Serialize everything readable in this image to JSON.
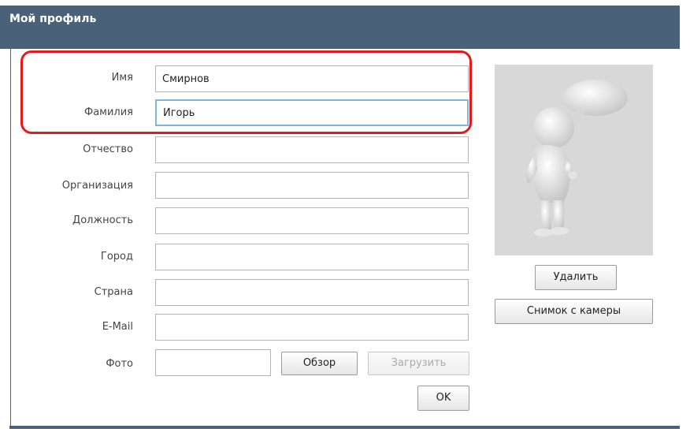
{
  "window": {
    "title": "Мой профиль"
  },
  "form": {
    "fields": [
      {
        "label": "Имя",
        "value": "Смирнов"
      },
      {
        "label": "Фамилия",
        "value": "Игорь"
      },
      {
        "label": "Отчество",
        "value": ""
      },
      {
        "label": "Организация",
        "value": ""
      },
      {
        "label": "Должность",
        "value": ""
      },
      {
        "label": "Город",
        "value": ""
      },
      {
        "label": "Страна",
        "value": ""
      },
      {
        "label": "E-Mail",
        "value": ""
      }
    ],
    "photo": {
      "label": "Фото",
      "value": ""
    },
    "browse_label": "Обзор",
    "upload_label": "Загрузить",
    "ok_label": "OK"
  },
  "avatar": {
    "delete_label": "Удалить",
    "camera_label": "Снимок с камеры"
  },
  "colors": {
    "titlebar": "#4a6278",
    "highlight": "#e41b1b",
    "focus": "#7db6dd"
  }
}
